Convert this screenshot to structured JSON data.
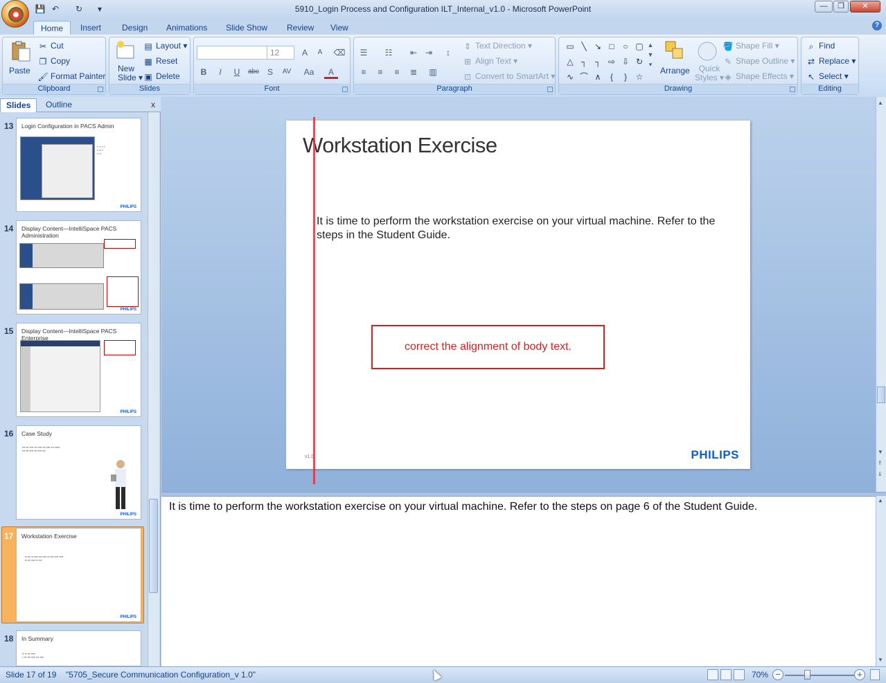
{
  "window": {
    "title": "5910_Login Process and Configuration ILT_Internal_v1.0 - Microsoft PowerPoint",
    "minimize": "—",
    "maximize": "❐",
    "close": "✕"
  },
  "qat": {
    "save": "💾",
    "undo": "↶",
    "redo": "↻",
    "customize": "▾"
  },
  "tabs": [
    "Home",
    "Insert",
    "Design",
    "Animations",
    "Slide Show",
    "Review",
    "View"
  ],
  "active_tab": "Home",
  "ribbon": {
    "clipboard": {
      "label": "Clipboard",
      "paste": "Paste",
      "cut": "Cut",
      "copy": "Copy",
      "format_painter": "Format Painter"
    },
    "slides": {
      "label": "Slides",
      "new_slide_1": "New",
      "new_slide_2": "Slide",
      "layout": "Layout",
      "reset": "Reset",
      "delete": "Delete"
    },
    "font": {
      "label": "Font",
      "font_name": "",
      "font_size": "12",
      "bold": "B",
      "italic": "I",
      "underline": "U",
      "strike": "abc",
      "shadow": "S",
      "spacing": "AV",
      "case": "Aa",
      "color": "A",
      "grow": "A",
      "shrink": "A"
    },
    "paragraph": {
      "label": "Paragraph",
      "text_direction": "Text Direction",
      "align_text": "Align Text",
      "convert_smartart": "Convert to SmartArt"
    },
    "drawing": {
      "label": "Drawing",
      "arrange": "Arrange",
      "quick_styles_1": "Quick",
      "quick_styles_2": "Styles",
      "shape_fill": "Shape Fill",
      "shape_outline": "Shape Outline",
      "shape_effects": "Shape Effects"
    },
    "editing": {
      "label": "Editing",
      "find": "Find",
      "replace": "Replace",
      "select": "Select"
    }
  },
  "left_pane": {
    "tabs": [
      "Slides",
      "Outline"
    ],
    "close": "x",
    "thumbnails": [
      {
        "num": "13",
        "title": "Login Configuration in PACS Admin"
      },
      {
        "num": "14",
        "title": "Display Content—IntelliSpace PACS Administration"
      },
      {
        "num": "15",
        "title": "Display Content—IntelliSpace PACS Enterprise"
      },
      {
        "num": "16",
        "title": "Case Study"
      },
      {
        "num": "17",
        "title": "Workstation Exercise"
      },
      {
        "num": "18",
        "title": "In Summary"
      }
    ],
    "logo": "PHILIPS"
  },
  "slide": {
    "title": "Workstation Exercise",
    "body": "It is time to perform the workstation exercise on your virtual machine. Refer to the steps in the Student Guide.",
    "comment": "correct the alignment of body text.",
    "version": "v1.0",
    "logo": "PHILIPS"
  },
  "notes": {
    "text": "It is time to perform the workstation exercise on your virtual machine. Refer to the steps on page 6 of the Student Guide."
  },
  "status": {
    "slide_info": "Slide 17 of 19",
    "theme": "\"5705_Secure Communication Configuration_v 1.0\"",
    "zoom": "70%",
    "zoom_out": "−",
    "zoom_in": "+"
  },
  "colors": {
    "accent": "#15428b",
    "comment_red": "#d21f1f",
    "philips_blue": "#0b5ed7",
    "selected_thumb": "#f6b25c"
  }
}
